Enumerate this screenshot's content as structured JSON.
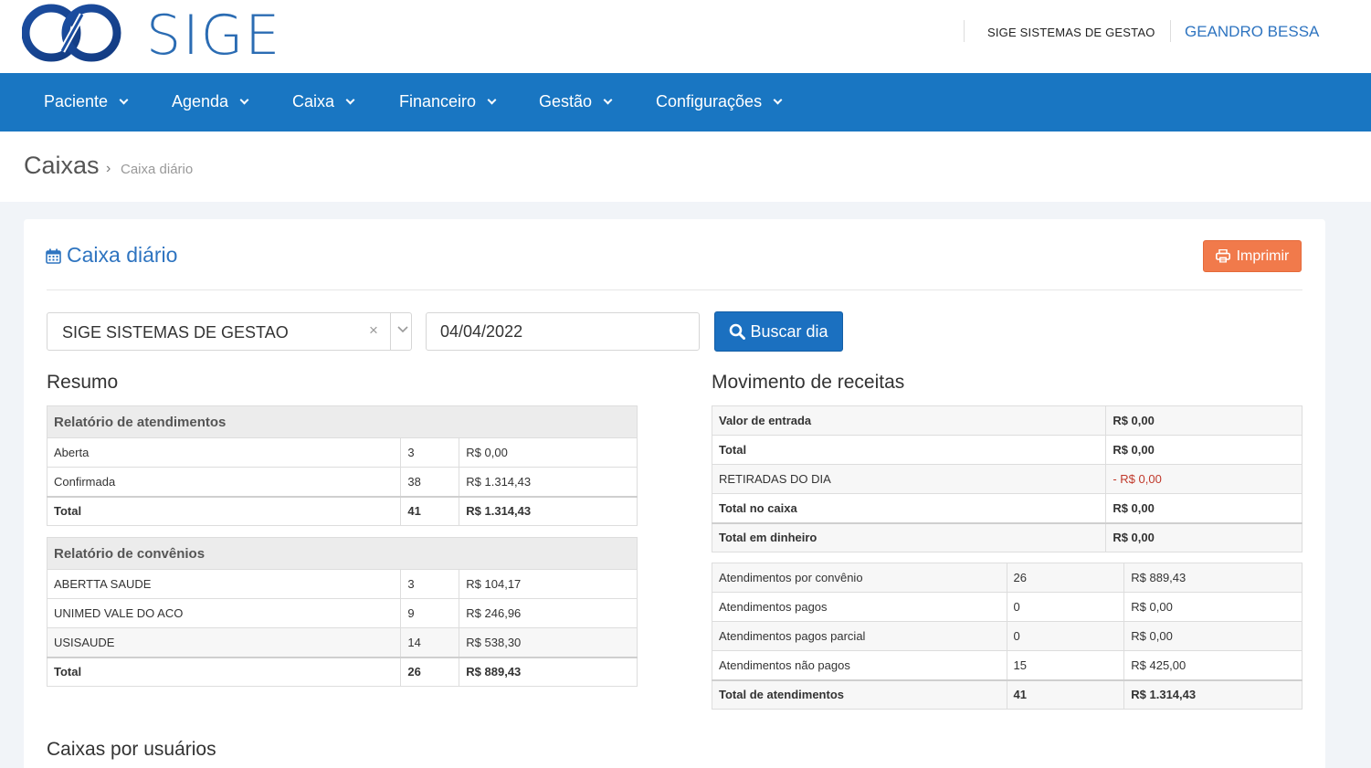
{
  "header": {
    "brand": "SIGE",
    "company": "SIGE SISTEMAS DE GESTAO",
    "user": "GEANDRO BESSA"
  },
  "nav": [
    {
      "label": "Paciente"
    },
    {
      "label": "Agenda"
    },
    {
      "label": "Caixa"
    },
    {
      "label": "Financeiro"
    },
    {
      "label": "Gestão"
    },
    {
      "label": "Configurações"
    }
  ],
  "breadcrumb": {
    "title": "Caixas",
    "separator": "›",
    "current": "Caixa diário"
  },
  "card": {
    "title": "Caixa diário",
    "print_label": "Imprimir",
    "select_value": "SIGE SISTEMAS DE GESTAO",
    "select_clear": "×",
    "date_value": "04/04/2022",
    "search_label": "Buscar dia"
  },
  "resumo": {
    "title": "Resumo",
    "atendimentos": {
      "header": "Relatório de atendimentos",
      "rows": [
        {
          "name": "Aberta",
          "count": "3",
          "value": "R$ 0,00"
        },
        {
          "name": "Confirmada",
          "count": "38",
          "value": "R$ 1.314,43"
        }
      ],
      "total": {
        "name": "Total",
        "count": "41",
        "value": "R$ 1.314,43"
      }
    },
    "convenios": {
      "header": "Relatório de convênios",
      "rows": [
        {
          "name": "ABERTTA SAUDE",
          "count": "3",
          "value": "R$ 104,17"
        },
        {
          "name": "UNIMED VALE DO ACO",
          "count": "9",
          "value": "R$ 246,96"
        },
        {
          "name": "USISAUDE",
          "count": "14",
          "value": "R$ 538,30"
        }
      ],
      "total": {
        "name": "Total",
        "count": "26",
        "value": "R$ 889,43"
      }
    }
  },
  "movimento": {
    "title": "Movimento de receitas",
    "valores": {
      "entrada": {
        "name": "Valor de entrada",
        "value": "R$ 0,00"
      },
      "total": {
        "name": "Total",
        "value": "R$ 0,00"
      },
      "retiradas": {
        "name": "RETIRADAS DO DIA",
        "value": "- R$ 0,00"
      },
      "total_caixa": {
        "name": "Total no caixa",
        "value": "R$ 0,00"
      },
      "total_dinheiro": {
        "name": "Total em dinheiro",
        "value": "R$ 0,00"
      }
    },
    "atendimentos": {
      "rows": [
        {
          "name": "Atendimentos por convênio",
          "count": "26",
          "value": "R$ 889,43"
        },
        {
          "name": "Atendimentos pagos",
          "count": "0",
          "value": "R$ 0,00"
        },
        {
          "name": "Atendimentos pagos parcial",
          "count": "0",
          "value": "R$ 0,00"
        },
        {
          "name": "Atendimentos não pagos",
          "count": "15",
          "value": "R$ 425,00"
        }
      ],
      "total": {
        "name": "Total de atendimentos",
        "count": "41",
        "value": "R$ 1.314,43"
      }
    }
  },
  "caixas_usuarios": {
    "title": "Caixas por usuários"
  },
  "colors": {
    "primary": "#1976c2",
    "accent_print": "#f17a4b",
    "negative": "#c0392b",
    "link": "#2e74c0"
  }
}
